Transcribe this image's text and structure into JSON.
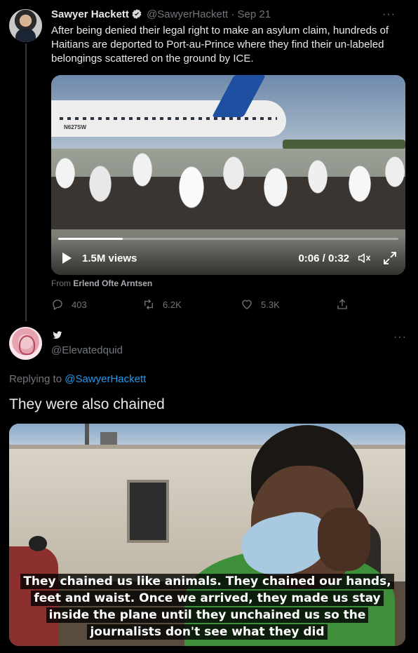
{
  "tweet": {
    "author_name": "Sawyer Hackett",
    "handle": "@SawyerHackett",
    "separator": "·",
    "date": "Sep 21",
    "more": "···",
    "text": "After being denied their legal right to make an asylum claim, hundreds of Haitians are deported to Port-au-Prince where they find their un-labeled belongings scattered on the ground by ICE.",
    "video": {
      "views": "1.5M views",
      "time": "0:06 / 0:32",
      "progress_fraction": 0.19,
      "plane_registration": "N627SW"
    },
    "from_prefix": "From",
    "from_name": "Erlend Ofte Arntsen",
    "stats": {
      "replies": "403",
      "retweets": "6.2K",
      "likes": "5.3K"
    }
  },
  "reply": {
    "handle": "@Elevatedquid",
    "more": "···",
    "replying_prefix": "Replying to",
    "replying_to": "@SawyerHackett",
    "text": "They were also chained",
    "video_caption": "They chained us like animals. They chained our hands, feet and waist. Once we arrived, they made us stay inside the plane until they unchained us so the journalists don't see what they did"
  },
  "colors": {
    "background": "#000000",
    "text": "#e7e9ea",
    "muted": "#71767b",
    "accent": "#1d9bf0"
  },
  "icons": [
    "verified-badge-icon",
    "reply-icon",
    "retweet-icon",
    "like-icon",
    "share-icon",
    "play-icon",
    "mute-icon",
    "expand-icon",
    "twitter-bird-icon"
  ]
}
